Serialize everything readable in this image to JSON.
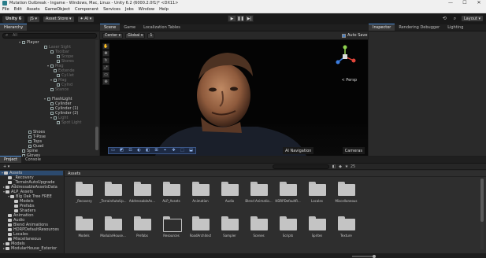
{
  "window": {
    "title": "Mutation Outbreak - Ingame - Windows, Mac, Linux - Unity 6.2 (6000.2.0f1)* <DX11>",
    "controls": [
      "—",
      "☐",
      "✕"
    ]
  },
  "menu": [
    "File",
    "Edit",
    "Assets",
    "GameObject",
    "Component",
    "Services",
    "Jobs",
    "Window",
    "Help"
  ],
  "toolbar": {
    "unity_label": "Unity 6",
    "account_label": "JS ▾",
    "asset_store_label": "Asset Store ▾",
    "ai_label": "✦ AI ▾",
    "play": "▶",
    "pause": "❚❚",
    "step": "▶|",
    "layout_label": "Layout ▾"
  },
  "hierarchy": {
    "tab_label": "Hierarchy",
    "search_placeholder": "All",
    "rows": [
      {
        "text": "Player",
        "indent": 24,
        "arrow": "▾",
        "dim": false
      },
      {
        "text": "Laser Sight",
        "indent": 56,
        "arrow": "",
        "dim": true
      },
      {
        "text": "Toolbar",
        "indent": 64,
        "arrow": "",
        "dim": true
      },
      {
        "text": "Scope",
        "indent": 72,
        "arrow": "",
        "dim": true
      },
      {
        "text": "Stores",
        "indent": 72,
        "arrow": "",
        "dim": true
      },
      {
        "text": "Mag",
        "indent": 60,
        "arrow": "▾",
        "dim": true
      },
      {
        "text": "Extende",
        "indent": 68,
        "arrow": "",
        "dim": true
      },
      {
        "text": "Cyl.let",
        "indent": 72,
        "arrow": "",
        "dim": true
      },
      {
        "text": "Mag",
        "indent": 64,
        "arrow": "▾",
        "dim": true
      },
      {
        "text": "Cylnd",
        "indent": 72,
        "arrow": "",
        "dim": true
      },
      {
        "text": "Stance",
        "indent": 64,
        "arrow": "",
        "dim": true
      },
      {
        "text": "",
        "indent": 0,
        "arrow": "",
        "dim": true
      },
      {
        "text": "FlashLight",
        "indent": 56,
        "arrow": "▾",
        "dim": false
      },
      {
        "text": "Cylinder",
        "indent": 64,
        "arrow": "",
        "dim": false
      },
      {
        "text": "Cylinder (1)",
        "indent": 64,
        "arrow": "",
        "dim": false
      },
      {
        "text": "Cylinder (2)",
        "indent": 64,
        "arrow": "",
        "dim": false
      },
      {
        "text": "Light",
        "indent": 64,
        "arrow": "▾",
        "dim": true
      },
      {
        "text": "Spot Light",
        "indent": 72,
        "arrow": "",
        "dim": true
      },
      {
        "text": "",
        "indent": 0,
        "arrow": "",
        "dim": true
      },
      {
        "text": "Shoes",
        "indent": 36,
        "arrow": "",
        "dim": false
      },
      {
        "text": "T-Pose",
        "indent": 36,
        "arrow": "",
        "dim": false
      },
      {
        "text": "Tops",
        "indent": 36,
        "arrow": "",
        "dim": false
      },
      {
        "text": "Quad",
        "indent": 36,
        "arrow": "",
        "dim": false
      },
      {
        "text": "Spine",
        "indent": 28,
        "arrow": "",
        "dim": false
      },
      {
        "text": "Gloves",
        "indent": 28,
        "arrow": "",
        "dim": false
      }
    ]
  },
  "scene": {
    "tabs": [
      "Scene",
      "Game",
      "Localization Tables"
    ],
    "pivot_label": "Center ▾",
    "space_label": "Global ▾",
    "snap_value": "1",
    "persp_label": "< Persp",
    "ai_nav_label": "AI Navigation",
    "cameras_label": "Cameras",
    "left_tools": [
      "✋",
      "✥",
      "↻",
      "⤢",
      "▭",
      "⊕"
    ],
    "bottom_tools": [
      "▭",
      "◩",
      "⊡",
      "◐",
      "◧",
      "⊞",
      "⌖",
      "✥",
      "⬚",
      "⬓"
    ]
  },
  "inspector": {
    "tabs": [
      "Inspector",
      "Rendering Debugger",
      "Lighting"
    ],
    "auto_save_label": "Auto Save"
  },
  "project": {
    "tabs": [
      "Project",
      "Console"
    ],
    "breadcrumb": "Assets",
    "count_label": "25",
    "tree": [
      {
        "text": "Assets",
        "indent": 2,
        "arrow": "▾",
        "sel": true
      },
      {
        "text": "_Recovery",
        "indent": 10,
        "arrow": "",
        "sel": false
      },
      {
        "text": "_TerrainAutoUpgrade",
        "indent": 10,
        "arrow": "",
        "sel": false
      },
      {
        "text": "AddressableAssetsData",
        "indent": 4,
        "arrow": "▸",
        "sel": false
      },
      {
        "text": "ALP_Assets",
        "indent": 4,
        "arrow": "▾",
        "sel": false
      },
      {
        "text": "Big Oak Tree FREE",
        "indent": 10,
        "arrow": "▾",
        "sel": false
      },
      {
        "text": "Models",
        "indent": 18,
        "arrow": "",
        "sel": false
      },
      {
        "text": "Prefabs",
        "indent": 18,
        "arrow": "",
        "sel": false
      },
      {
        "text": "Shaders",
        "indent": 18,
        "arrow": "",
        "sel": false
      },
      {
        "text": "Animation",
        "indent": 10,
        "arrow": "",
        "sel": false
      },
      {
        "text": "Audio",
        "indent": 10,
        "arrow": "",
        "sel": false
      },
      {
        "text": "Blend Animations",
        "indent": 10,
        "arrow": "",
        "sel": false
      },
      {
        "text": "HDRPDefaultResources",
        "indent": 10,
        "arrow": "",
        "sel": false
      },
      {
        "text": "Locales",
        "indent": 10,
        "arrow": "",
        "sel": false
      },
      {
        "text": "Miscellaneous",
        "indent": 10,
        "arrow": "",
        "sel": false
      },
      {
        "text": "Models",
        "indent": 4,
        "arrow": "▸",
        "sel": false
      },
      {
        "text": "ModularHouse_Exterior",
        "indent": 4,
        "arrow": "▸",
        "sel": false
      }
    ],
    "folders": [
      {
        "label": "_Recovery",
        "open": false
      },
      {
        "label": "_TerrainAutoUp...",
        "open": false
      },
      {
        "label": "AddressableAs...",
        "open": false
      },
      {
        "label": "ALP_Assets",
        "open": false
      },
      {
        "label": "Animation",
        "open": false
      },
      {
        "label": "Audio",
        "open": false
      },
      {
        "label": "Blend Animatio...",
        "open": false
      },
      {
        "label": "HDRPDefaultR...",
        "open": false
      },
      {
        "label": "Locales",
        "open": false
      },
      {
        "label": "Miscellaneous",
        "open": false
      },
      {
        "label": "Models",
        "open": false
      },
      {
        "label": "ModularHouse...",
        "open": false
      },
      {
        "label": "Prefabs",
        "open": false
      },
      {
        "label": "Resources",
        "open": true
      },
      {
        "label": "RoadArchitect",
        "open": false
      },
      {
        "label": "Sampler",
        "open": false
      },
      {
        "label": "Scenes",
        "open": false
      },
      {
        "label": "Scripts",
        "open": false
      },
      {
        "label": "Sprites",
        "open": false
      },
      {
        "label": "Texture",
        "open": false
      }
    ]
  }
}
